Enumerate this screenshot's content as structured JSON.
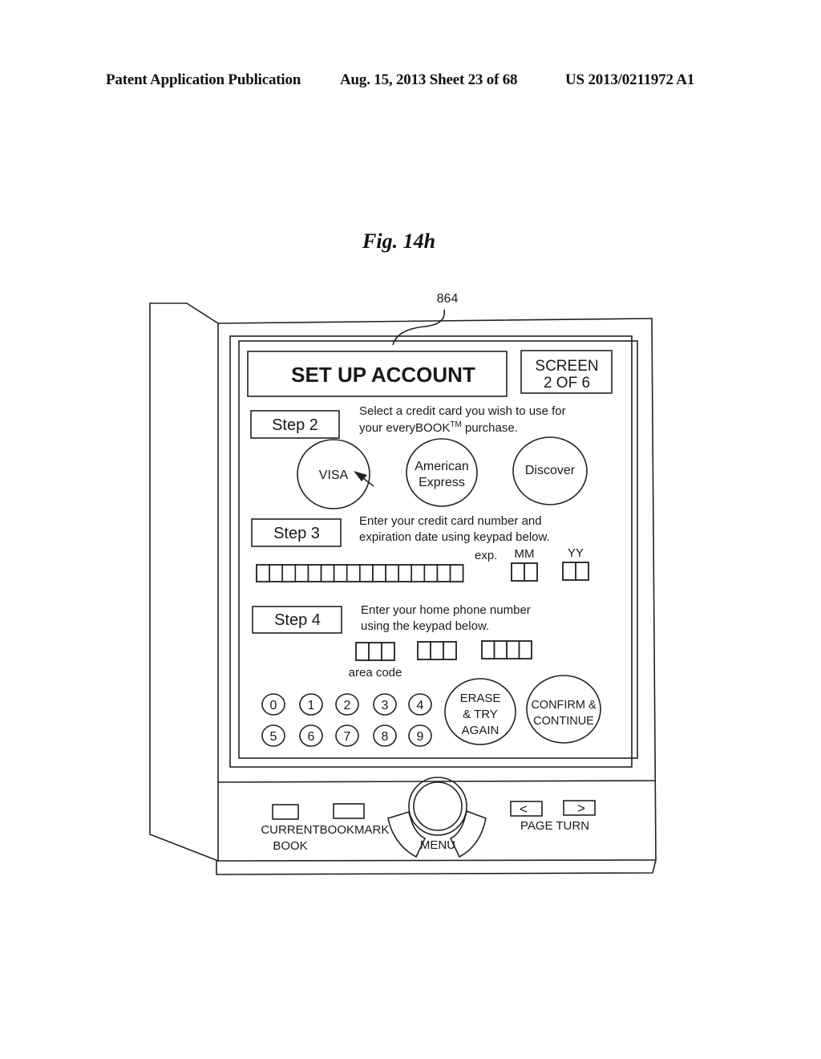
{
  "header": {
    "publication": "Patent Application Publication",
    "date_sheet": "Aug. 15, 2013  Sheet 23 of 68",
    "patent_number": "US 2013/0211972 A1"
  },
  "figure": {
    "title": "Fig. 14h",
    "reference_numeral": "864"
  },
  "screen": {
    "title": "SET UP ACCOUNT",
    "screen_indicator": {
      "line1": "SCREEN",
      "line2": "2 OF 6"
    },
    "step2": {
      "label": "Step 2",
      "instruction_line1": "Select a credit card you wish to use for",
      "instruction_line2_prefix": "your everyBOOK",
      "instruction_line2_tm": "TM",
      "instruction_line2_suffix": " purchase.",
      "cards": [
        {
          "line1": "VISA",
          "line2": ""
        },
        {
          "line1": "American",
          "line2": "Express"
        },
        {
          "line1": "Discover",
          "line2": ""
        }
      ]
    },
    "step3": {
      "label": "Step 3",
      "instruction_line1": "Enter your credit card number and",
      "instruction_line2": "expiration date using keypad below.",
      "exp_label": "exp.",
      "mm_label": "MM",
      "yy_label": "YY",
      "card_number_digits": 16,
      "mm_digits": 2,
      "yy_digits": 2
    },
    "step4": {
      "label": "Step 4",
      "instruction_line1": "Enter your home phone number",
      "instruction_line2": "using the keypad below.",
      "phone_groups": [
        3,
        3,
        4
      ],
      "area_code_label": "area code"
    },
    "keypad": {
      "row1": [
        "0",
        "1",
        "2",
        "3",
        "4"
      ],
      "row2": [
        "5",
        "6",
        "7",
        "8",
        "9"
      ]
    },
    "erase_button": {
      "line1": "ERASE",
      "line2": "& TRY",
      "line3": "AGAIN"
    },
    "confirm_button": {
      "line1": "CONFIRM &",
      "line2": "CONTINUE"
    }
  },
  "device_controls": {
    "current_book": {
      "line1": "CURRENT",
      "line2": "BOOK"
    },
    "bookmark": "BOOKMARK",
    "menu": "MENU",
    "page_turn": "PAGE TURN",
    "prev_glyph": "<",
    "next_glyph": ">"
  }
}
